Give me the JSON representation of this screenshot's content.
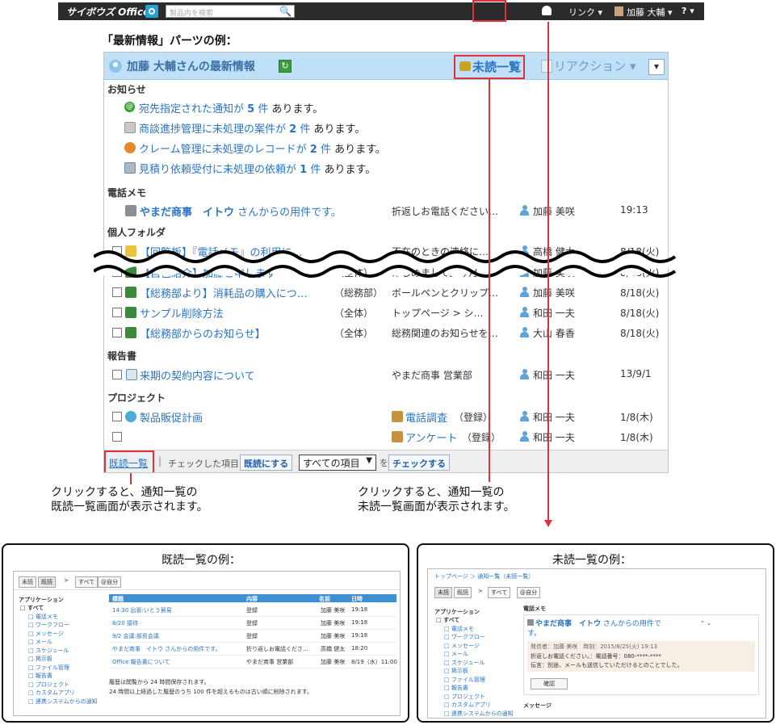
{
  "topbar": {
    "logo": "サイボウズ Office",
    "search_placeholder": "製品内を検索",
    "link": "リンク ▾",
    "user": "加藤 大輔 ▾",
    "help": "? ▾"
  },
  "heading": "「最新情報」パーツの例：",
  "panel": {
    "title": "加藤 大輔さんの最新情報",
    "unread": "未読一覧",
    "reaction": "リアクション ▾",
    "sections": {
      "info": "お知らせ",
      "phone": "電話メモ",
      "personal": "個人フォルダ",
      "report": "報告書",
      "project": "プロジェクト"
    },
    "notices": [
      {
        "pre": "宛先指定された通知が",
        "count": "5",
        "post": "件",
        "tail": "あります。"
      },
      {
        "pre": "商談進捗管理に未処理の案件が",
        "count": "2",
        "post": "件",
        "tail": "あります。"
      },
      {
        "pre": "クレーム管理に未処理のレコードが",
        "count": "2",
        "post": "件",
        "tail": "あります。"
      },
      {
        "pre": "見積り依頼受付に未処理の依頼が",
        "count": "1",
        "post": "件",
        "tail": "あります。"
      }
    ],
    "phone_row": {
      "title": "やまだ商事　イトウ",
      "suffix": "さんからの用件です。",
      "memo": "折返しお電話ください…",
      "user": "加藤 美咲",
      "time": "19:13"
    },
    "folder_rows": [
      {
        "title": "【回覧板】『電話メモ』の利用に…",
        "scope": "",
        "memo": "不在のときの連絡に…",
        "user": "高橋 健太",
        "time": "8/18(火)"
      },
      {
        "title": "【自己紹介】加藤と申します",
        "scope": "（全体）",
        "memo": "はじめまして。今月…",
        "user": "加藤 美咲",
        "time": "8/18(火)"
      },
      {
        "title": "【総務部より】消耗品の購入につ…",
        "scope": "（総務部）",
        "memo": "ボールペンとクリップ…",
        "user": "加藤 美咲",
        "time": "8/18(火)"
      },
      {
        "title": "サンプル削除方法",
        "scope": "（全体）",
        "memo": "トップページ > シ…",
        "user": "和田 一夫",
        "time": "8/18(火)"
      },
      {
        "title": "【総務部からのお知らせ】",
        "scope": "（全体）",
        "memo": "総務関連のお知らせを…",
        "user": "大山 春香",
        "time": "8/18(火)"
      }
    ],
    "report_row": {
      "title": "来期の契約内容について",
      "memo": "やまだ商事 営業部",
      "user": "和田 一夫",
      "time": "13/9/1"
    },
    "project_rows": [
      {
        "title": "製品販促計画",
        "memo": "電話調査",
        "scope": "（登録）",
        "user": "和田 一夫",
        "time": "1/8(木)"
      },
      {
        "title": "",
        "memo": "アンケート",
        "scope": "（登録）",
        "user": "和田 一夫",
        "time": "1/8(木)"
      }
    ],
    "footer": {
      "read": "既読一覧",
      "sep": "|",
      "checked": "チェックした項目を",
      "mark_read": "既読にする",
      "select": "すべての項目",
      "wo": "を",
      "check": "チェックする"
    }
  },
  "captions": {
    "left": [
      "クリックすると、通知一覧の",
      "既読一覧画面が表示されます。"
    ],
    "right": [
      "クリックすると、通知一覧の",
      "未読一覧画面が表示されます。"
    ]
  },
  "read_example": {
    "title": "既読一覧の例：",
    "tabs": [
      "未読",
      "既読",
      "すべて",
      "@自分"
    ],
    "app_label": "アプリケーション",
    "apps": [
      "すべて",
      "電話メモ",
      "ワークフロー",
      "メッセージ",
      "メール",
      "スケジュール",
      "掲示板",
      "ファイル管理",
      "報告書",
      "プロジェクト",
      "カスタムアプリ",
      "連携システムからの通知"
    ],
    "cols": [
      "標題",
      "内容",
      "名前",
      "日時"
    ],
    "rows": [
      {
        "t": "14:30 出張:いとう貿易",
        "c": "登録",
        "n": "加藤 美咲",
        "d": "19:18"
      },
      {
        "t": "8/20 接待",
        "c": "登録",
        "n": "加藤 美咲",
        "d": "19:18"
      },
      {
        "t": "9/2 会議:部長会議",
        "c": "登録",
        "n": "加藤 美咲",
        "d": "19:18"
      },
      {
        "t": "やまだ商事　イトウ さんからの用件です。",
        "c": "折り返しお電話くださ…",
        "n": "高橋 健太",
        "d": "18:20"
      },
      {
        "t": "Office 報告書について",
        "c": "やまだ商事 営業部",
        "n": "加藤 美咲",
        "d": "8/19（水）11:00"
      }
    ],
    "note1": "履歴は閲覧から 24 時間保存されます。",
    "note2": "24 時間以上経過した履歴のうち 100 件を超えるものは古い順に削除されます。"
  },
  "unread_example": {
    "title": "未読一覧の例：",
    "breadcrumb": "トップページ ＞ 通知一覧（未読一覧）",
    "tabs": [
      "未読",
      "既読",
      "すべて",
      "@自分"
    ],
    "app_label": "アプリケーション",
    "apps": [
      "すべて",
      "電話メモ",
      "ワークフロー",
      "メッセージ",
      "メール",
      "スケジュール",
      "掲示板",
      "ファイル管理",
      "報告書",
      "プロジェクト",
      "カスタムアプリ",
      "連携システムからの通知"
    ],
    "section": "電話メモ",
    "card_title": "やまだ商事　イトウ",
    "card_suffix": "さんからの用件で",
    "card_suffix2": "す。",
    "sender": "発信者：加藤 美咲　時刻：2015/8/25(火) 19:13",
    "body1": "折返しお電話ください。：電話番号：080-****-****",
    "body2": "伝言：別途、メールも送信していただけるとのことでした。",
    "confirm": "確認",
    "msg_section": "メッセージ"
  }
}
